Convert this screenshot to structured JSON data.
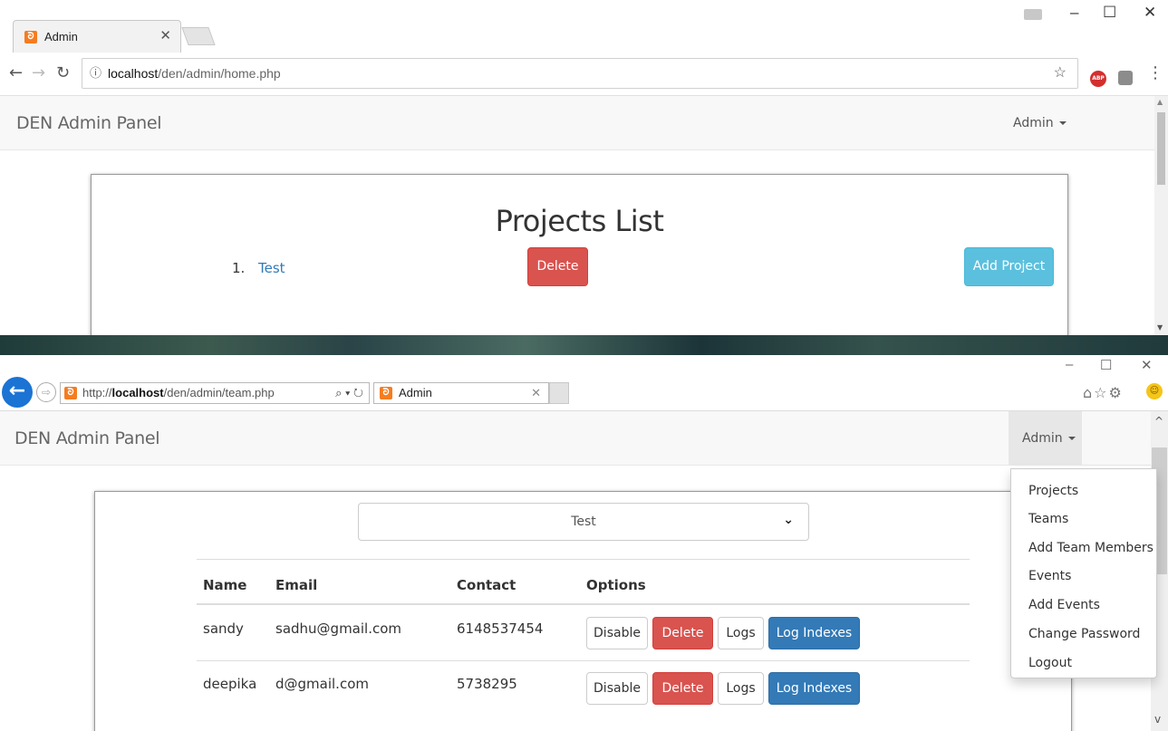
{
  "chrome": {
    "tab_title": "Admin",
    "url_host": "localhost",
    "url_path": "/den/admin/home.php",
    "ext_label": "ABP"
  },
  "page1": {
    "brand": "DEN Admin Panel",
    "admin_label": "Admin",
    "title": "Projects List",
    "projects": [
      {
        "num": "1.",
        "name": "Test"
      }
    ],
    "delete_label": "Delete",
    "add_project_label": "Add Project"
  },
  "ie": {
    "url_prefix": "http://",
    "url_host": "localhost",
    "url_path": "/den/admin/team.php",
    "tab_title": "Admin"
  },
  "page2": {
    "brand": "DEN Admin Panel",
    "admin_label": "Admin",
    "selected_project": "Test",
    "columns": [
      "Name",
      "Email",
      "Contact",
      "Options"
    ],
    "rows": [
      {
        "name": "sandy",
        "email": "sadhu@gmail.com",
        "contact": "6148537454"
      },
      {
        "name": "deepika",
        "email": "d@gmail.com",
        "contact": "5738295"
      }
    ],
    "row_buttons": {
      "disable": "Disable",
      "delete": "Delete",
      "logs": "Logs",
      "log_indexes": "Log Indexes"
    },
    "dropdown_items": [
      "Projects",
      "Teams",
      "Add Team Members",
      "Events",
      "Add Events",
      "Change Password",
      "Logout"
    ]
  },
  "colors": {
    "danger": "#d9534f",
    "info": "#5bc0de",
    "primary": "#337ab7",
    "link": "#337ab7",
    "ie_blue": "#1b73d4"
  }
}
